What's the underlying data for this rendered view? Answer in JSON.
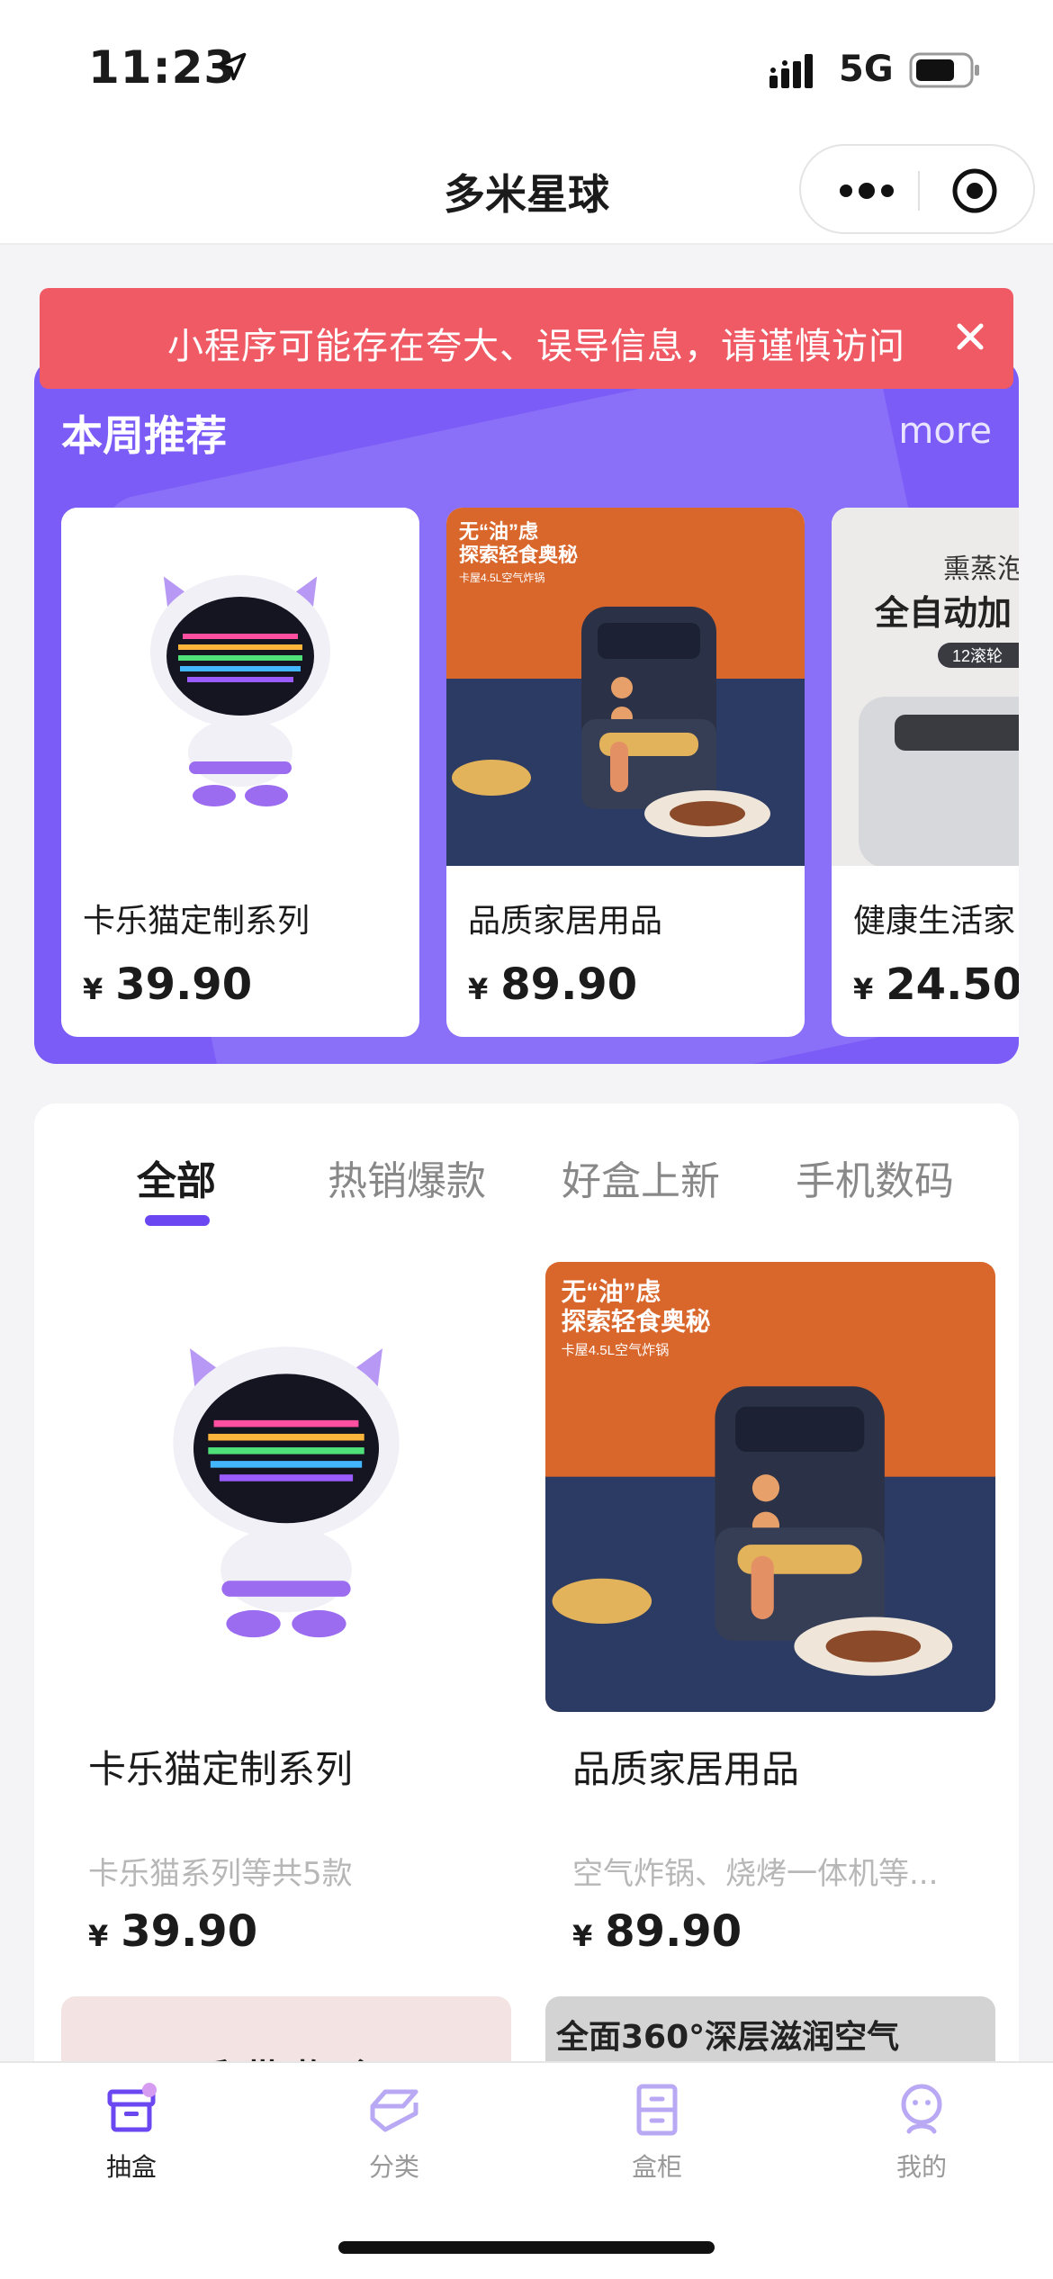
{
  "status_bar": {
    "time": "11:23",
    "network": "5G"
  },
  "nav": {
    "title": "多米星球"
  },
  "alert": {
    "text": "小程序可能存在夸大、误导信息，请谨慎访问"
  },
  "weekly": {
    "title": "本周推荐",
    "more": "more",
    "items": [
      {
        "name": "卡乐猫定制系列",
        "currency": "¥",
        "price": "39.90"
      },
      {
        "name": "品质家居用品",
        "currency": "¥",
        "price": "89.90"
      },
      {
        "name": "健康生活家",
        "currency": "¥",
        "price": "24.50"
      }
    ],
    "item3_img_text": [
      "熏蒸泡",
      "全自动加",
      "12滚轮"
    ]
  },
  "airfryer_img_text": [
    "无“油”虑",
    "探索轻食奥秘",
    "卡屋4.5L空气炸锅"
  ],
  "tabs": [
    "全部",
    "热销爆款",
    "好盒上新",
    "手机数码"
  ],
  "products": [
    {
      "name": "卡乐猫定制系列",
      "desc": "卡乐猫系列等共5款",
      "currency": "¥",
      "price": "39.90"
    },
    {
      "name": "品质家居用品",
      "desc": "空气炸锅、烧烤一体机等...",
      "currency": "¥",
      "price": "89.90"
    }
  ],
  "peek": {
    "left_text": "手 带 物 令",
    "right_text": "全面360°深层滋润空气"
  },
  "tabbar": [
    "抽盒",
    "分类",
    "盒柜",
    "我的"
  ],
  "colors": {
    "accent": "#6a47f0",
    "panel": "#7b5cf6",
    "alert": "#f05a64"
  }
}
